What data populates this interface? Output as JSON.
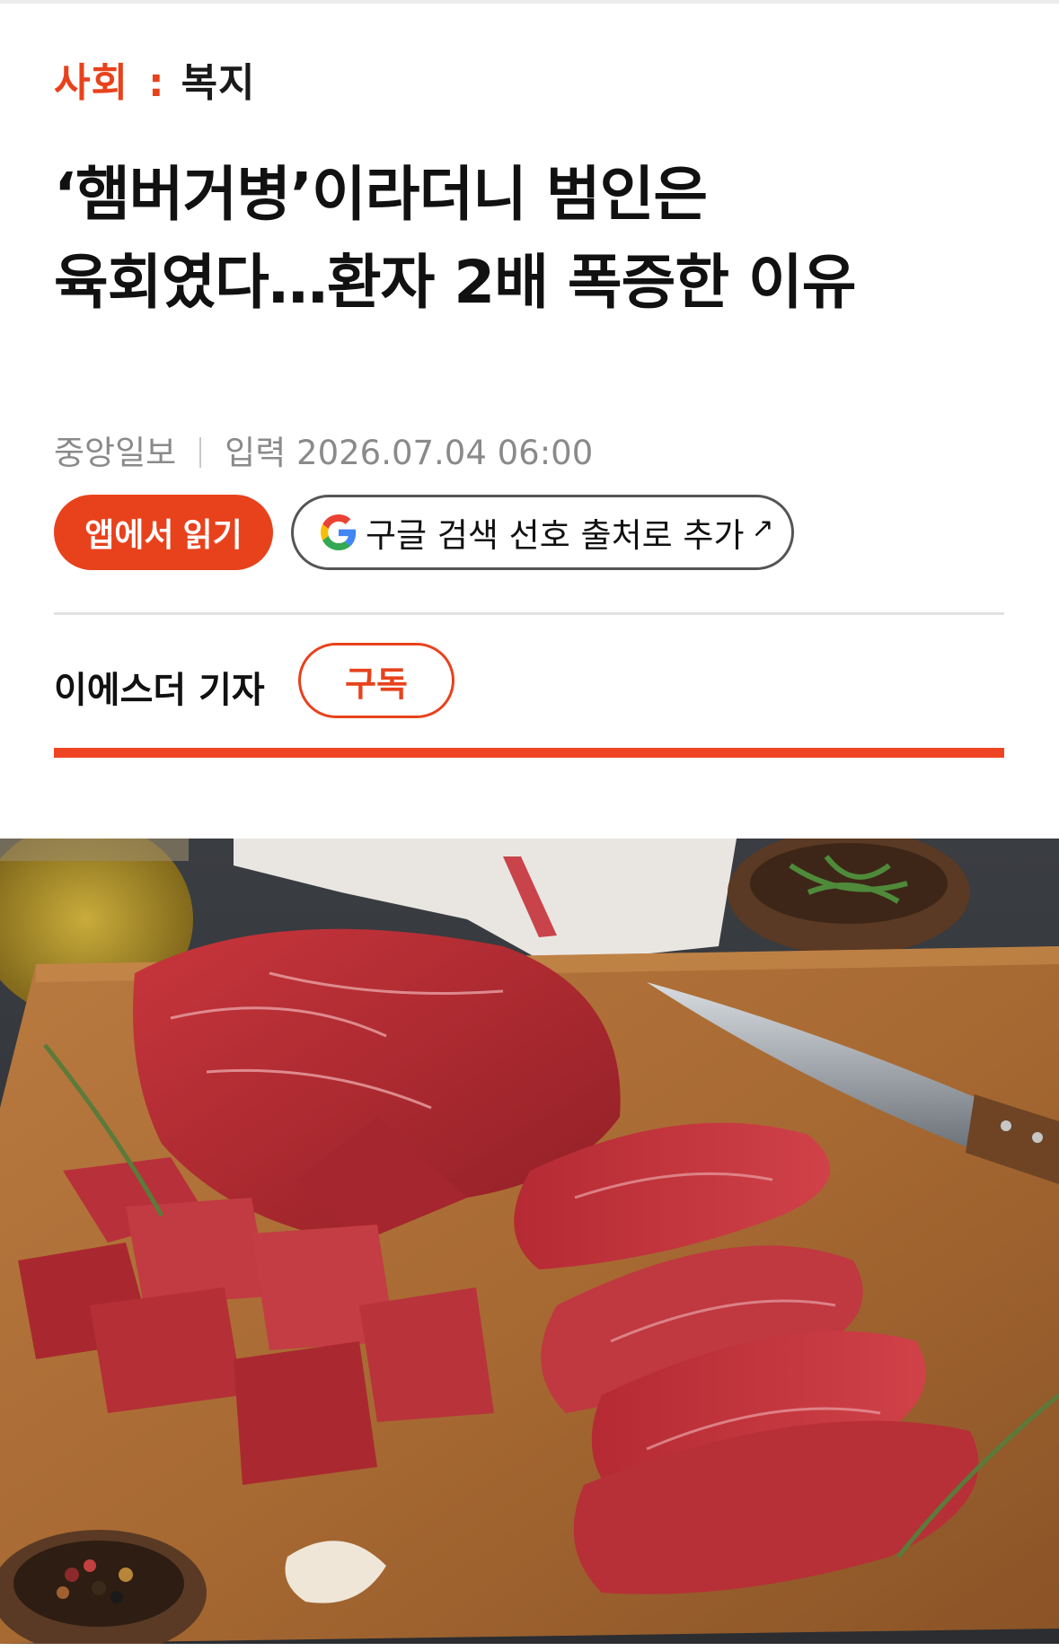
{
  "category": {
    "section": "사회",
    "separator": ":",
    "subsection": "복지"
  },
  "headline": {
    "line1": "‘햄버거병’이라더니 범인은",
    "line2": "육회였다…환자 2배 폭증한 이유"
  },
  "meta": {
    "publisher": "중앙일보",
    "input_label": "입력",
    "datetime": "2026.07.04 06:00"
  },
  "buttons": {
    "app_read": "앱에서 읽기",
    "google_source": "구글 검색 선호 출처로 추가",
    "google_arrow": "↗",
    "subscribe": "구독"
  },
  "reporter": {
    "name": "이에스더 기자"
  },
  "colors": {
    "accent": "#e8421c",
    "meta_text": "#8a8a8a",
    "divider": "#e2e2e2"
  },
  "icons": {
    "google": "google-g-icon",
    "external": "external-arrow-icon"
  },
  "image": {
    "subject": "raw beef on cutting board with knife, herbs, oil, peppercorns, garlic"
  }
}
